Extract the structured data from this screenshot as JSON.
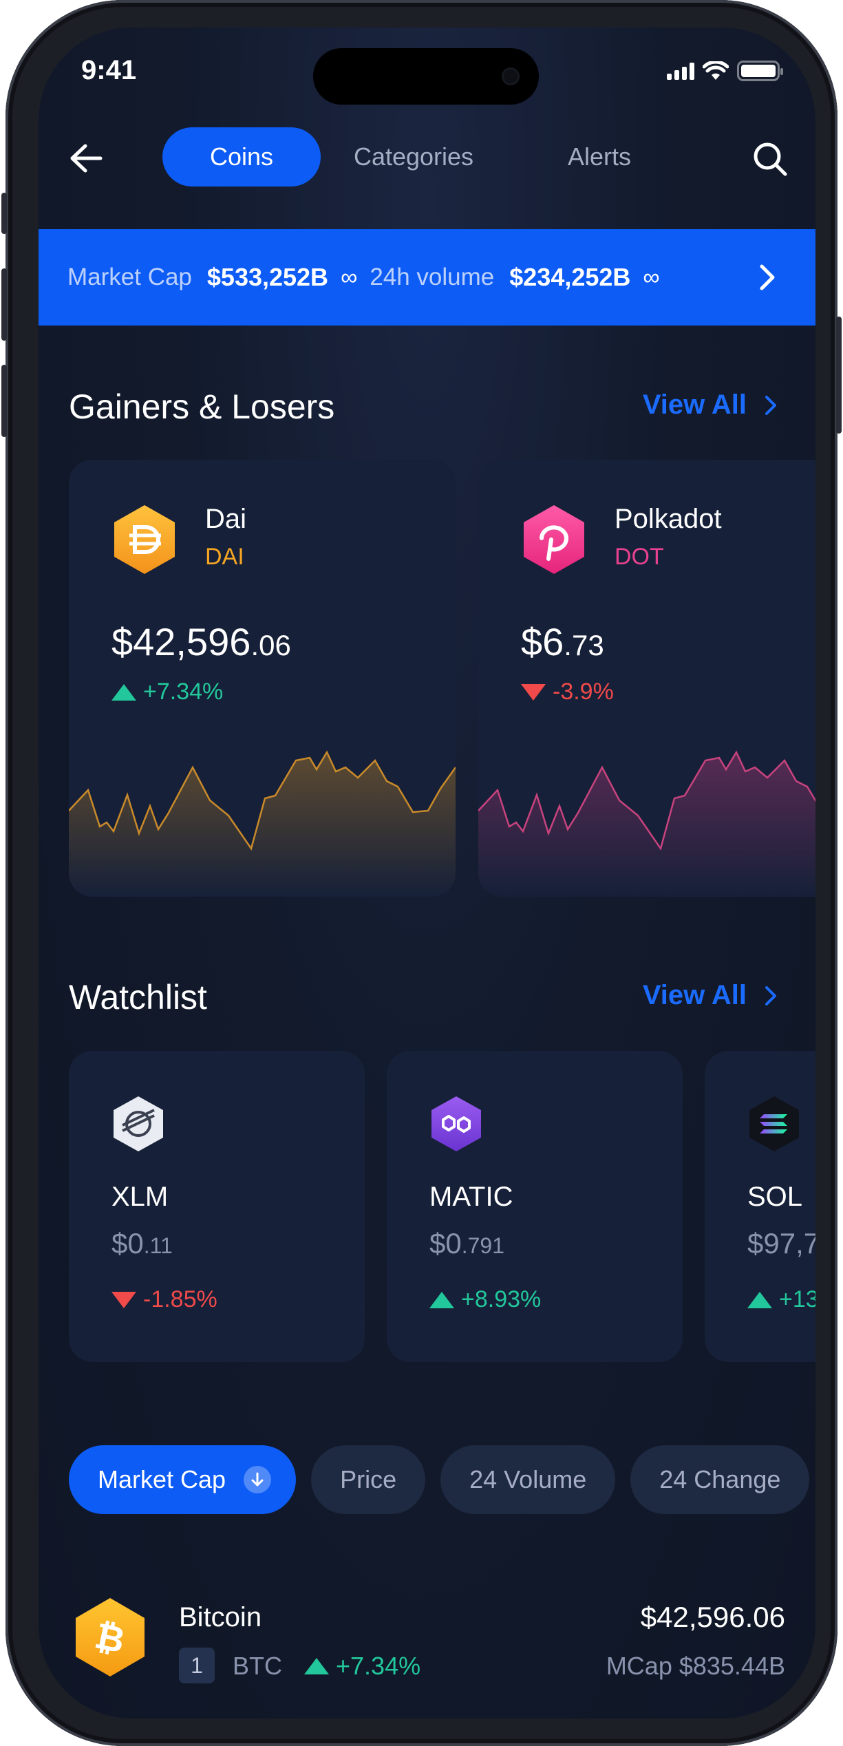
{
  "status_bar": {
    "time": "9:41"
  },
  "nav": {
    "tabs": [
      {
        "label": "Coins",
        "active": true
      },
      {
        "label": "Categories",
        "active": false
      },
      {
        "label": "Alerts",
        "active": false
      }
    ]
  },
  "ticker": {
    "market_cap_label": "Market Cap",
    "market_cap_value": "$533,252B",
    "volume_label": "24h volume",
    "volume_value": "$234,252B"
  },
  "gainers": {
    "title": "Gainers & Losers",
    "view_all": "View All",
    "cards": [
      {
        "name": "Dai",
        "symbol": "DAI",
        "price_main": "$42,596",
        "price_decimal": ".06",
        "change": "+7.34%",
        "direction": "up",
        "color": "#f6a623"
      },
      {
        "name": "Polkadot",
        "symbol": "DOT",
        "price_main": "$6",
        "price_decimal": ".73",
        "change": "-3.9%",
        "direction": "down",
        "color": "#e6428f"
      }
    ]
  },
  "watchlist": {
    "title": "Watchlist",
    "view_all": "View All",
    "cards": [
      {
        "symbol": "XLM",
        "price_main": "$0",
        "price_decimal": ".11",
        "change": "-1.85%",
        "direction": "down",
        "icon": "stellar-icon"
      },
      {
        "symbol": "MATIC",
        "price_main": "$0",
        "price_decimal": ".791",
        "change": "+8.93%",
        "direction": "up",
        "icon": "polygon-icon"
      },
      {
        "symbol": "SOL",
        "price_main": "$97,7",
        "price_decimal": "",
        "change": "+13",
        "direction": "up",
        "icon": "solana-icon"
      }
    ]
  },
  "filters": {
    "pills": [
      "Market Cap",
      "Price",
      "24 Volume",
      "24 Change"
    ],
    "active": "Market Cap"
  },
  "coins": [
    {
      "name": "Bitcoin",
      "rank": "1",
      "symbol": "BTC",
      "change": "+7.34%",
      "direction": "up",
      "price": "$42,596.06",
      "mcap": "MCap $835.44B"
    }
  ],
  "colors": {
    "accent": "#0d5cf5",
    "up": "#22c79b",
    "down": "#f04a4a",
    "card": "#162038"
  }
}
